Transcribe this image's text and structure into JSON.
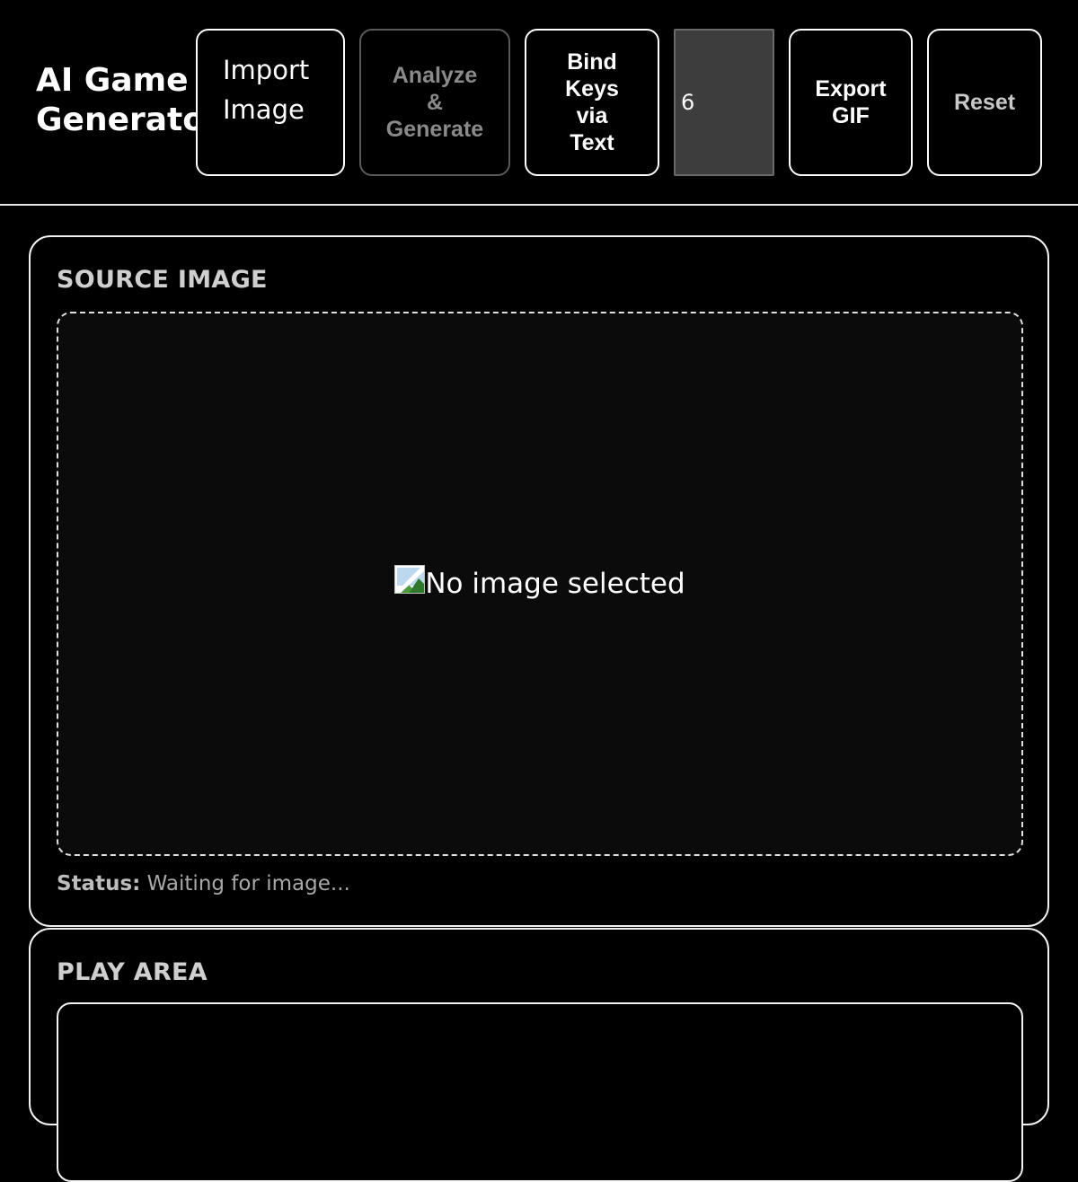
{
  "app": {
    "title": "AI Game\nGenerator"
  },
  "toolbar": {
    "import_label": "Import\nImage",
    "analyze_label": "Analyze\n&\nGenerate",
    "bind_label": "Bind\nKeys\nvia\nText",
    "count_value": "6",
    "export_label": "Export\nGIF",
    "reset_label": "Reset"
  },
  "source_panel": {
    "heading": "SOURCE IMAGE",
    "preview_alt": "No image selected",
    "status_label": "Status:",
    "status_text": "Waiting for image..."
  },
  "play_panel": {
    "heading": "PLAY AREA"
  },
  "icons": {
    "broken_image": "broken-image-icon"
  },
  "colors": {
    "background": "#000000",
    "foreground": "#ffffff",
    "muted": "#8a8a8a",
    "input_bg": "#3d3d3d"
  }
}
